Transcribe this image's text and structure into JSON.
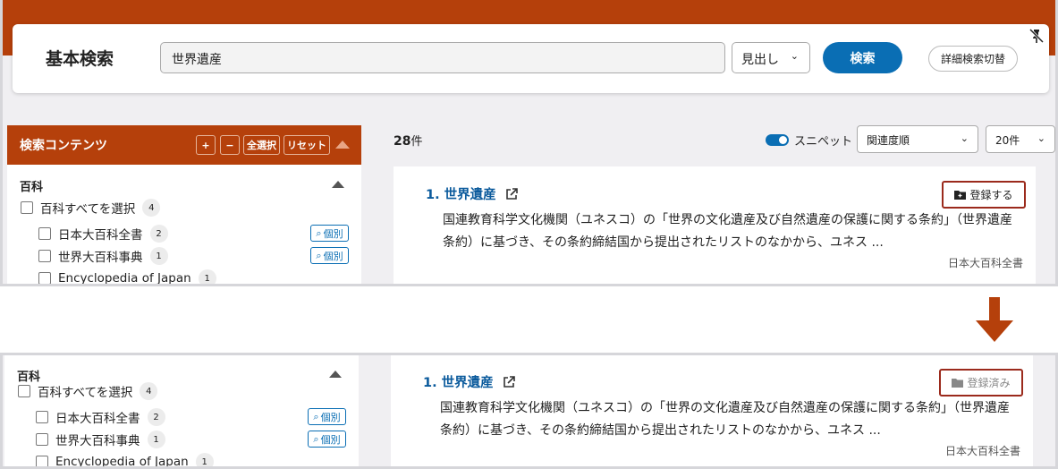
{
  "header": {
    "title": "基本検索",
    "search_value": "世界遺産",
    "mode_select": "見出し",
    "search_button": "検索",
    "advanced_toggle": "詳細検索切替"
  },
  "sidebar": {
    "heading": "検索コンテンツ",
    "plus": "+",
    "minus": "−",
    "select_all": "全選択",
    "reset": "リセット",
    "category": "百科",
    "select_all_items": "百科すべてを選択",
    "select_all_count": "4",
    "items": [
      {
        "label": "日本大百科全書",
        "count": "2",
        "button": "個別"
      },
      {
        "label": "世界大百科事典",
        "count": "1",
        "button": "個別"
      },
      {
        "label": "Encyclopedia of Japan",
        "count": "1"
      }
    ]
  },
  "results": {
    "count_number": "28",
    "count_suffix": "件",
    "snippet_label": "スニペット",
    "sort": "関連度順",
    "per_page": "20件",
    "items": [
      {
        "index": "1.",
        "title": "世界遺産",
        "description": "国連教育科学文化機関（ユネスコ）の「世界の文化遺産及び自然遺産の保護に関する条約」（世界遺産条約）に基づき、その条約締結国から提出されたリストのなかから、ユネス ...",
        "source": "日本大百科全書"
      }
    ],
    "register_before": "登録する",
    "register_after": "登録済み"
  },
  "colors": {
    "brand": "#b5400b",
    "accent": "#0a6eb4",
    "highlight_border": "#9b2a1c"
  }
}
